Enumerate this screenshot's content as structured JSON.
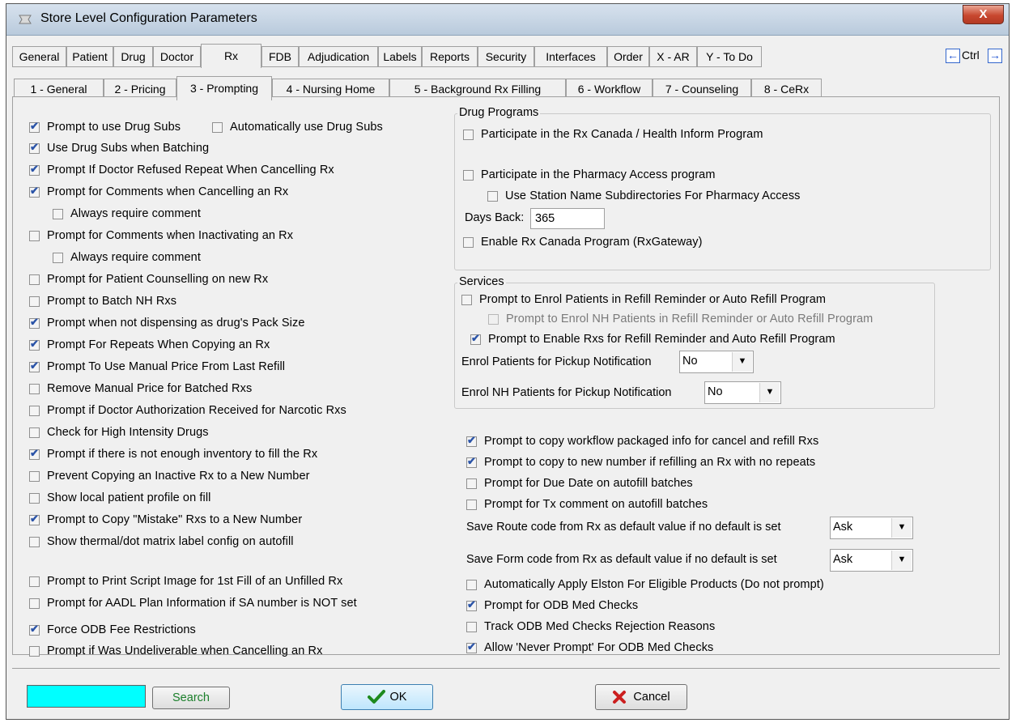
{
  "window": {
    "title": "Store Level Configuration Parameters",
    "close_glyph": "X"
  },
  "main_tabs": [
    {
      "label": "General"
    },
    {
      "label": "Patient"
    },
    {
      "label": "Drug"
    },
    {
      "label": "Doctor"
    },
    {
      "label": "Rx",
      "active": true
    },
    {
      "label": "FDB"
    },
    {
      "label": "Adjudication"
    },
    {
      "label": "Labels"
    },
    {
      "label": "Reports"
    },
    {
      "label": "Security"
    },
    {
      "label": "Interfaces"
    },
    {
      "label": "Order"
    },
    {
      "label": "X - AR"
    },
    {
      "label": "Y - To Do"
    }
  ],
  "tab_nav": {
    "ctrl_label": "Ctrl"
  },
  "sub_tabs": [
    {
      "label": "1 - General"
    },
    {
      "label": "2 - Pricing"
    },
    {
      "label": "3 - Prompting",
      "active": true
    },
    {
      "label": "4 - Nursing Home"
    },
    {
      "label": "5 - Background Rx Filling"
    },
    {
      "label": "6 - Workflow"
    },
    {
      "label": "7 - Counseling"
    },
    {
      "label": "8 - CeRx"
    }
  ],
  "left_options": [
    {
      "label": "Prompt to use Drug Subs",
      "checked": true
    },
    {
      "label": "Automatically use Drug Subs",
      "checked": false
    },
    {
      "label": "Use Drug Subs when Batching",
      "checked": true
    },
    {
      "label": "Prompt If Doctor Refused Repeat When Cancelling Rx",
      "checked": true
    },
    {
      "label": "Prompt for Comments when Cancelling an Rx",
      "checked": true
    },
    {
      "label": "Always require comment",
      "checked": false
    },
    {
      "label": "Prompt for Comments when Inactivating an Rx",
      "checked": false
    },
    {
      "label": "Always require comment",
      "checked": false
    },
    {
      "label": "Prompt for Patient Counselling on new Rx",
      "checked": false
    },
    {
      "label": "Prompt to Batch NH Rxs",
      "checked": false
    },
    {
      "label": "Prompt when not dispensing as drug's Pack Size",
      "checked": true
    },
    {
      "label": "Prompt For Repeats When Copying an Rx",
      "checked": true
    },
    {
      "label": "Prompt To Use Manual Price From Last Refill",
      "checked": true
    },
    {
      "label": "Remove Manual Price for Batched Rxs",
      "checked": false
    },
    {
      "label": "Prompt if Doctor Authorization Received for Narcotic Rxs",
      "checked": false
    },
    {
      "label": "Check for High Intensity Drugs",
      "checked": false
    },
    {
      "label": "Prompt if there is not enough inventory to fill the Rx",
      "checked": true
    },
    {
      "label": "Prevent Copying  an Inactive Rx to a New Number",
      "checked": false
    },
    {
      "label": "Show local patient profile on fill",
      "checked": false
    },
    {
      "label": "Prompt to Copy \"Mistake\" Rxs to a New Number",
      "checked": true
    },
    {
      "label": "Show thermal/dot matrix label config on autofill",
      "checked": false
    },
    {
      "label": "Prompt to Print Script Image for 1st Fill of an Unfilled Rx",
      "checked": false
    },
    {
      "label": "Prompt for AADL Plan Information if SA number is NOT set",
      "checked": false
    },
    {
      "label": "Force ODB Fee Restrictions",
      "checked": true
    },
    {
      "label": "Prompt if Was Undeliverable when Cancelling an Rx",
      "checked": false
    }
  ],
  "drug_programs": {
    "title": "Drug Programs",
    "options": [
      {
        "label": "Participate in the Rx Canada / Health Inform Program",
        "checked": false
      },
      {
        "label": "Participate in the Pharmacy Access program",
        "checked": false
      },
      {
        "label": "Use Station Name Subdirectories For Pharmacy Access",
        "checked": false
      },
      {
        "label": "Enable Rx Canada Program (RxGateway)",
        "checked": false
      }
    ],
    "days_back_label": "Days Back:",
    "days_back_value": "365"
  },
  "services": {
    "title": "Services",
    "options": [
      {
        "label": "Prompt to Enrol Patients in Refill Reminder or Auto Refill Program",
        "checked": false
      },
      {
        "label": "Prompt to Enrol NH Patients in Refill Reminder or Auto Refill Program",
        "checked": false,
        "disabled": true
      },
      {
        "label": "Prompt to Enable Rxs for Refill Reminder and Auto Refill Program",
        "checked": true
      }
    ],
    "pickup_label": "Enrol Patients for Pickup Notification",
    "pickup_value": "No",
    "nh_pickup_label": "Enrol NH Patients for Pickup Notification",
    "nh_pickup_value": "No"
  },
  "right_options": [
    {
      "label": "Prompt to copy workflow packaged info for cancel and refill Rxs",
      "checked": true
    },
    {
      "label": "Prompt to copy to new number if refilling an Rx with no repeats",
      "checked": true
    },
    {
      "label": "Prompt for Due Date on autofill batches",
      "checked": false
    },
    {
      "label": "Prompt for Tx comment on autofill batches",
      "checked": false
    }
  ],
  "route_code": {
    "label": "Save Route code from Rx as default value if no default is set",
    "value": "Ask"
  },
  "form_code": {
    "label": "Save Form code from Rx as default value if no default is set",
    "value": "Ask"
  },
  "right_options_2": [
    {
      "label": "Automatically Apply Elston For Eligible Products (Do not prompt)",
      "checked": false
    },
    {
      "label": "Prompt for ODB Med Checks",
      "checked": true
    },
    {
      "label": "Track ODB Med Checks Rejection Reasons",
      "checked": false
    },
    {
      "label": "Allow 'Never Prompt' For ODB Med Checks",
      "checked": true
    }
  ],
  "footer": {
    "search_value": "",
    "search_label": "Search",
    "ok_label": "OK",
    "cancel_label": "Cancel"
  },
  "colors": {
    "search_box": "#00ffff",
    "ok_check": "#1e8a1e",
    "cancel_x": "#cc1f1f",
    "checkmark": "#2b54a8"
  }
}
